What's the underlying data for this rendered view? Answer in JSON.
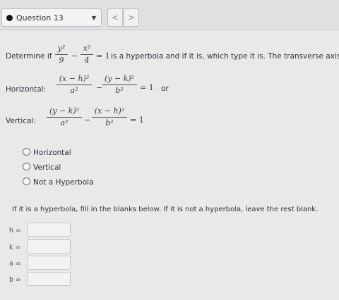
{
  "header": {
    "question_label": "Question 13",
    "prev_glyph": "<",
    "next_glyph": ">",
    "dropdown_glyph": "▼"
  },
  "prompt": {
    "lead": "Determine if",
    "eq_num1": "y²",
    "eq_den1": "9",
    "eq_minus": "−",
    "eq_num2": "x²",
    "eq_den2": "4",
    "eq_rhs": "= 1",
    "tail": "is a hyperbola and if it is, which type it is.  The transverse axis is"
  },
  "forms": {
    "horizontal_label": "Horizontal:",
    "h_num1": "(x − h)²",
    "h_den1": "a²",
    "h_num2": "(y − k)²",
    "h_den2": "b²",
    "h_rhs": "= 1",
    "or_text": "or",
    "vertical_label": "Vertical:",
    "v_num1": "(y − k)²",
    "v_den1": "a²",
    "v_num2": "(x − h)²",
    "v_den2": "b²",
    "v_rhs": "= 1",
    "minus": "−"
  },
  "options": [
    {
      "label": "Horizontal",
      "selected": false
    },
    {
      "label": "Vertical",
      "selected": false
    },
    {
      "label": "Not a Hyperbola",
      "selected": false
    }
  ],
  "instruction": "If it is a hyperbola, fill in the blanks below.  If it is not a hyperbola, leave the rest blank.",
  "blanks": [
    {
      "label": "h =",
      "value": ""
    },
    {
      "label": "k =",
      "value": ""
    },
    {
      "label": "a =",
      "value": ""
    },
    {
      "label": "b =",
      "value": ""
    }
  ]
}
